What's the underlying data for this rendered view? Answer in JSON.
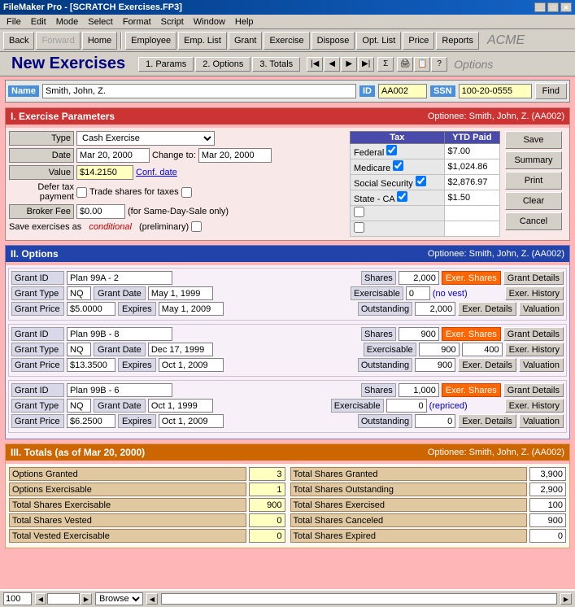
{
  "window": {
    "title": "FileMaker Pro - [SCRATCH Exercises.FP3]"
  },
  "menu": {
    "items": [
      "File",
      "Edit",
      "Mode",
      "Select",
      "Format",
      "Script",
      "Window",
      "Help"
    ]
  },
  "toolbar": {
    "buttons": [
      "Back",
      "Forward",
      "Home",
      "Employee",
      "Emp. List",
      "Grant",
      "Exercise",
      "Dispose",
      "Opt. List",
      "Price",
      "Reports"
    ]
  },
  "tabs": {
    "title": "New Exercises",
    "params_label": "1. Params",
    "options_label": "2. Options",
    "totals_label": "3. Totals",
    "acme_label": "ACME",
    "options_label2": "Options"
  },
  "header": {
    "name_label": "Name",
    "name_value": "Smith, John, Z.",
    "id_label": "ID",
    "id_value": "AA002",
    "ssn_label": "SSN",
    "ssn_value": "100-20-0555",
    "find_btn": "Find"
  },
  "section1": {
    "title": "I. Exercise Parameters",
    "optionee": "Optionee: Smith, John, Z. (AA002)",
    "type_label": "Type",
    "type_value": "Cash Exercise",
    "date_label": "Date",
    "date_value": "Mar 20, 2000",
    "change_to_label": "Change to:",
    "change_to_value": "Mar 20, 2000",
    "value_label": "Value",
    "value_value": "$14.2150",
    "conf_date_label": "Conf. date",
    "defer_label": "Defer tax payment",
    "trade_label": "Trade shares for taxes",
    "broker_label": "Broker Fee",
    "broker_value": "$0.00",
    "broker_note": "(for Same-Day-Sale only)",
    "save_label": "Save exercises as",
    "conditional_text": "conditional",
    "preliminary_text": "(preliminary)",
    "buttons": {
      "save": "Save",
      "summary": "Summary",
      "print": "Print",
      "clear": "Clear",
      "cancel": "Cancel"
    },
    "tax_table": {
      "headers": [
        "Tax",
        "YTD Paid"
      ],
      "rows": [
        {
          "label": "Federal",
          "checked": true,
          "value": "$7.00"
        },
        {
          "label": "Medicare",
          "checked": true,
          "value": "$1,024.86"
        },
        {
          "label": "Social Security",
          "checked": true,
          "value": "$2,876.97"
        },
        {
          "label": "State - CA",
          "checked": true,
          "value": "$1.50"
        },
        {
          "label": "",
          "checked": false,
          "value": ""
        },
        {
          "label": "",
          "checked": false,
          "value": ""
        }
      ]
    }
  },
  "section2": {
    "title": "II. Options",
    "optionee": "Optionee: Smith, John, Z. (AA002)",
    "grants": [
      {
        "id_label": "Grant ID",
        "id_value": "Plan 99A - 2",
        "shares_label": "Shares",
        "shares_value": "2,000",
        "exer_shares_btn": "Exer. Shares",
        "grant_details_btn": "Grant Details",
        "type_label": "Grant Type",
        "type_value": "NQ",
        "date_label": "Grant Date",
        "date_value": "May 1, 1999",
        "exercisable_label": "Exercisable",
        "exercisable_value": "0",
        "exercisable_note": "(no vest)",
        "exer_history_btn": "Exer. History",
        "price_label": "Grant Price",
        "price_value": "$5.0000",
        "expires_label": "Expires",
        "expires_value": "May 1, 2009",
        "outstanding_label": "Outstanding",
        "outstanding_value": "2,000",
        "exer_details_btn": "Exer. Details",
        "valuation_btn": "Valuation"
      },
      {
        "id_label": "Grant ID",
        "id_value": "Plan 99B - 8",
        "shares_label": "Shares",
        "shares_value": "900",
        "exer_shares_btn": "Exer. Shares",
        "grant_details_btn": "Grant Details",
        "type_label": "Grant Type",
        "type_value": "NQ",
        "date_label": "Grant Date",
        "date_value": "Dec 17, 1999",
        "exercisable_label": "Exercisable",
        "exercisable_value": "900",
        "exercisable_value2": "400",
        "exer_history_btn": "Exer. History",
        "price_label": "Grant Price",
        "price_value": "$13.3500",
        "expires_label": "Expires",
        "expires_value": "Oct 1, 2009",
        "outstanding_label": "Outstanding",
        "outstanding_value": "900",
        "exer_details_btn": "Exer. Details",
        "valuation_btn": "Valuation"
      },
      {
        "id_label": "Grant ID",
        "id_value": "Plan 99B - 6",
        "shares_label": "Shares",
        "shares_value": "1,000",
        "exer_shares_btn": "Exer. Shares",
        "grant_details_btn": "Grant Details",
        "type_label": "Grant Type",
        "type_value": "NQ",
        "date_label": "Grant Date",
        "date_value": "Oct 1, 1999",
        "exercisable_label": "Exercisable",
        "exercisable_value": "0",
        "exercisable_note": "(repriced)",
        "exer_history_btn": "Exer. History",
        "price_label": "Grant Price",
        "price_value": "$6.2500",
        "expires_label": "Expires",
        "expires_value": "Oct 1, 2009",
        "outstanding_label": "Outstanding",
        "outstanding_value": "0",
        "exer_details_btn": "Exer. Details",
        "valuation_btn": "Valuation"
      }
    ]
  },
  "section3": {
    "title": "III. Totals (as of Mar 20, 2000)",
    "optionee": "Optionee: Smith, John, Z. (AA002)",
    "left_col": [
      {
        "label": "Options Granted",
        "value": "3"
      },
      {
        "label": "Options Exercisable",
        "value": "1"
      },
      {
        "label": "Total Shares Exercisable",
        "value": "900"
      },
      {
        "label": "Total Shares Vested",
        "value": "0"
      },
      {
        "label": "Total Vested Exercisable",
        "value": "0"
      }
    ],
    "right_col": [
      {
        "label": "Total Shares Granted",
        "value": "3,900"
      },
      {
        "label": "Total Shares Outstanding",
        "value": "2,900"
      },
      {
        "label": "Total Shares Exercised",
        "value": "100"
      },
      {
        "label": "Total Shares Canceled",
        "value": "900"
      },
      {
        "label": "Total Shares Expired",
        "value": "0"
      }
    ]
  },
  "statusbar": {
    "zoom": "100",
    "mode": "Browse"
  }
}
